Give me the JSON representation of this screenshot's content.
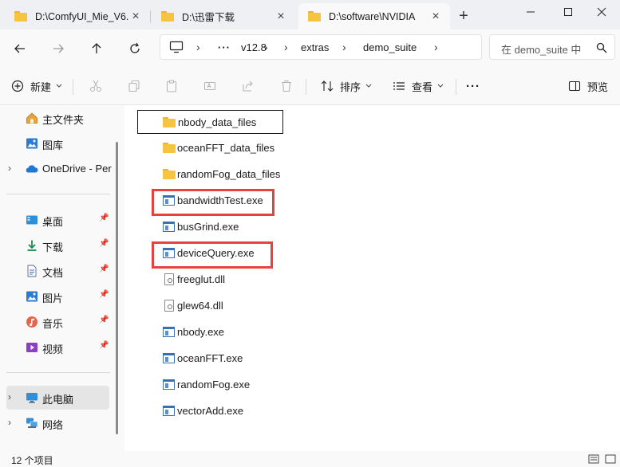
{
  "tabs": [
    {
      "label": "D:\\ComfyUI_Mie_V6.",
      "active": false
    },
    {
      "label": "D:\\迅雷下载",
      "active": false
    },
    {
      "label": "D:\\software\\NVIDIA",
      "active": true
    }
  ],
  "window_controls": {
    "minimize": "—",
    "maximize": "☐",
    "close": "✕"
  },
  "address": {
    "overflow": "···",
    "crumbs": [
      "v12.8",
      "extras",
      "demo_suite"
    ]
  },
  "search": {
    "placeholder": "在 demo_suite 中"
  },
  "toolbar": {
    "new_label": "新建",
    "sort_label": "排序",
    "view_label": "查看",
    "more_label": "···",
    "preview_label": "预览"
  },
  "sidebar": {
    "items": [
      {
        "label": "主文件夹",
        "icon": "home-icon"
      },
      {
        "label": "图库",
        "icon": "gallery-icon"
      },
      {
        "label": "OneDrive - Per",
        "icon": "onedrive-icon"
      },
      {
        "label": "桌面",
        "icon": "desktop-icon"
      },
      {
        "label": "下载",
        "icon": "download-icon"
      },
      {
        "label": "文档",
        "icon": "documents-icon"
      },
      {
        "label": "图片",
        "icon": "pictures-icon"
      },
      {
        "label": "音乐",
        "icon": "music-icon"
      },
      {
        "label": "视频",
        "icon": "videos-icon"
      },
      {
        "label": "此电脑",
        "icon": "this-pc-icon"
      },
      {
        "label": "网络",
        "icon": "network-icon"
      }
    ]
  },
  "files": [
    {
      "name": "nbody_data_files",
      "type": "folder"
    },
    {
      "name": "oceanFFT_data_files",
      "type": "folder"
    },
    {
      "name": "randomFog_data_files",
      "type": "folder"
    },
    {
      "name": "bandwidthTest.exe",
      "type": "exe"
    },
    {
      "name": "busGrind.exe",
      "type": "exe"
    },
    {
      "name": "deviceQuery.exe",
      "type": "exe"
    },
    {
      "name": "freeglut.dll",
      "type": "dll"
    },
    {
      "name": "glew64.dll",
      "type": "dll"
    },
    {
      "name": "nbody.exe",
      "type": "exe"
    },
    {
      "name": "oceanFFT.exe",
      "type": "exe"
    },
    {
      "name": "randomFog.exe",
      "type": "exe"
    },
    {
      "name": "vectorAdd.exe",
      "type": "exe"
    }
  ],
  "status": {
    "item_count": "12 个项目"
  },
  "colors": {
    "highlight": "#e8413f",
    "accent": "#3a6fb0",
    "folder": "#f5c542"
  }
}
